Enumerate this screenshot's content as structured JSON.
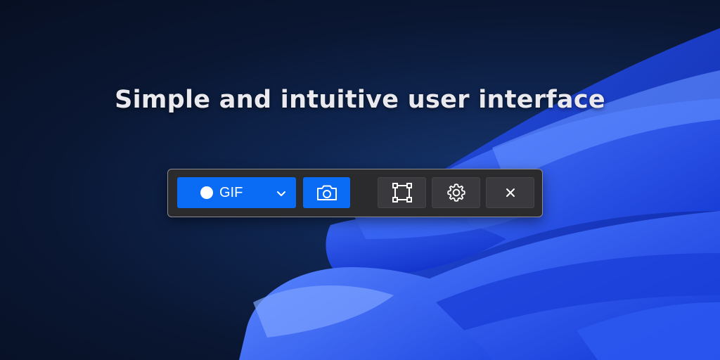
{
  "headline": "Simple and intuitive user interface",
  "toolbar": {
    "record_mode_label": "GIF",
    "colors": {
      "accent": "#0a6cf5",
      "panel": "#2b2b2e",
      "button": "#3a3a3e"
    },
    "icons": {
      "record": "record-dot-icon",
      "dropdown": "chevron-down-icon",
      "screenshot": "camera-icon",
      "region": "crop-region-icon",
      "settings": "gear-icon",
      "close": "close-icon"
    }
  }
}
